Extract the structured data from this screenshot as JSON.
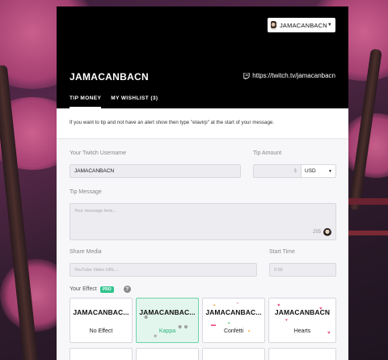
{
  "header": {
    "user_select": "JAMACANBACN",
    "streamer_name": "JAMACANBACN",
    "channel_url": "https://twitch.tv/jamacanbacn"
  },
  "tabs": [
    {
      "label": "TIP MONEY",
      "active": true
    },
    {
      "label": "MY WISHLIST (3)",
      "active": false
    }
  ],
  "notice": "If you want to tip and not have an alert show then type \"etavirp\" at the start of your message.",
  "form": {
    "username_label": "Your Twitch Username",
    "username_value": "JAMACANBACN",
    "amount_label": "Tip Amount",
    "amount_value": "",
    "amount_suffix": "$",
    "currency": "USD",
    "message_label": "Tip Message",
    "message_placeholder": "Your message here...",
    "message_count": "255",
    "media_label": "Share Media",
    "media_placeholder": "YouTube Video URL...",
    "start_label": "Start Time",
    "start_placeholder": "0:00",
    "effect_label": "Your Effect",
    "pro_badge": "PRO"
  },
  "effects": [
    {
      "title": "JAMACANBAC...",
      "name": "No Effect",
      "selected": false
    },
    {
      "title": "JAMACANBAC...",
      "name": "Kappa",
      "selected": true
    },
    {
      "title": "JAMACANBAC...",
      "name": "Confetti",
      "selected": false
    },
    {
      "title": "JAMACANBACN",
      "name": "Hearts",
      "selected": false
    }
  ],
  "colors": {
    "panel_bg": "#f7f7f9",
    "header_bg": "#000000",
    "accent_green": "#31c48d",
    "selected_card_bg": "#e3f6ee"
  }
}
